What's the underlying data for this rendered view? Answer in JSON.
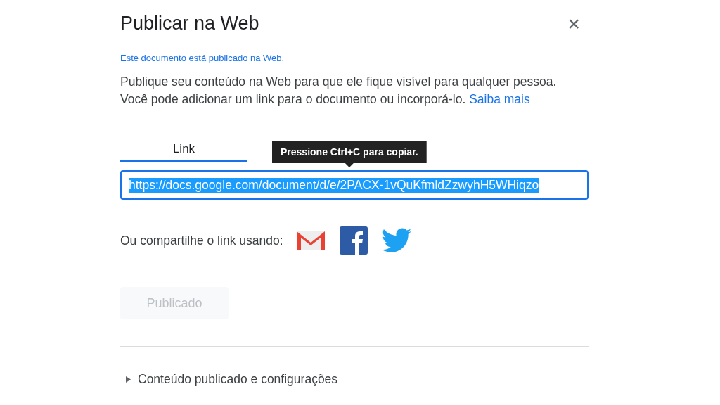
{
  "dialog": {
    "title": "Publicar na Web",
    "close": "×"
  },
  "status": "Este documento está publicado na Web.",
  "description": "Publique seu conteúdo na Web para que ele fique visível para qualquer pessoa. Você pode adicionar um link para o documento ou incorporá-lo.",
  "learn_more": "Saiba mais",
  "tabs": [
    {
      "label": "Link",
      "selected": true
    }
  ],
  "tooltip": "Pressione Ctrl+C para copiar.",
  "url_field": {
    "value": "https://docs.google.com/document/d/e/2PACX-1vQuKfmldZzwyhH5WHiqzo",
    "selected": true
  },
  "share": {
    "label": "Ou compartilhe o link usando:",
    "services": [
      {
        "kind": "gmail"
      },
      {
        "kind": "facebook"
      },
      {
        "kind": "twitter"
      }
    ]
  },
  "publish_button": {
    "label": "Publicado",
    "disabled": true
  },
  "settings": {
    "label": "Conteúdo publicado e configurações",
    "expanded": false
  }
}
